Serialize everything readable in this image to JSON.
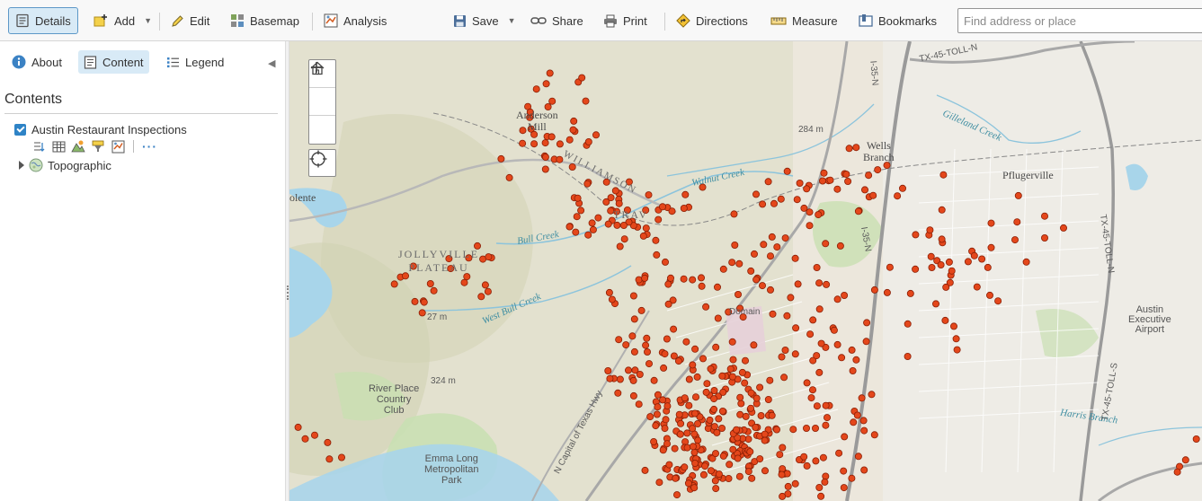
{
  "toolbar": {
    "details": "Details",
    "add": "Add",
    "edit": "Edit",
    "basemap": "Basemap",
    "analysis": "Analysis",
    "save": "Save",
    "share": "Share",
    "print": "Print",
    "directions": "Directions",
    "measure": "Measure",
    "bookmarks": "Bookmarks",
    "search_placeholder": "Find address or place"
  },
  "panel": {
    "tabs": [
      {
        "label": "About",
        "active": false
      },
      {
        "label": "Content",
        "active": true
      },
      {
        "label": "Legend",
        "active": false
      }
    ],
    "heading": "Contents",
    "layer": {
      "name": "Austin Restaurant Inspections",
      "checked": true
    },
    "basemap_layer": "Topographic",
    "more_label": "···"
  },
  "map": {
    "labels": {
      "anderson_mill": "Anderson\nMill",
      "wells_branch": "Wells\nBranch",
      "pflugerville": "Pflugerville",
      "jollyville": "JOLLYVILLE\nPLATEAU",
      "river_place": "River Place\nCountry\nClub",
      "emma_long": "Emma Long\nMetropolitan\nPark",
      "austin_exec": "Austin\nExecutive\nAirport",
      "bull_creek": "Bull Creek",
      "west_bull_creek": "West Bull Creek",
      "walnut_creek": "Walnut Creek",
      "gilleland_creek": "Gilleland Creek",
      "harris_branch": "Harris Branch",
      "olente": "olente",
      "travis": "TRAV",
      "williamson": "WILLIAMSON",
      "elev_284": "284 m",
      "elev_324": "324 m",
      "elev_27": "27 m",
      "i35n": "I-35-N",
      "i35n_2": "I-35-N",
      "tx45": "TX-45-TOLL-N",
      "tx45_v": "TX-45-TOLL-N",
      "tx45_s": "TX-45-TOLL-S",
      "domain": "Domain",
      "capital_tx": "N Capital of Texas Hwy"
    },
    "colors": {
      "marker": "#e4471b",
      "marker_stroke": "#8a1f06",
      "terrain": "#ece7dc",
      "water": "#a8d5ea",
      "park": "#c9e0b2"
    }
  }
}
